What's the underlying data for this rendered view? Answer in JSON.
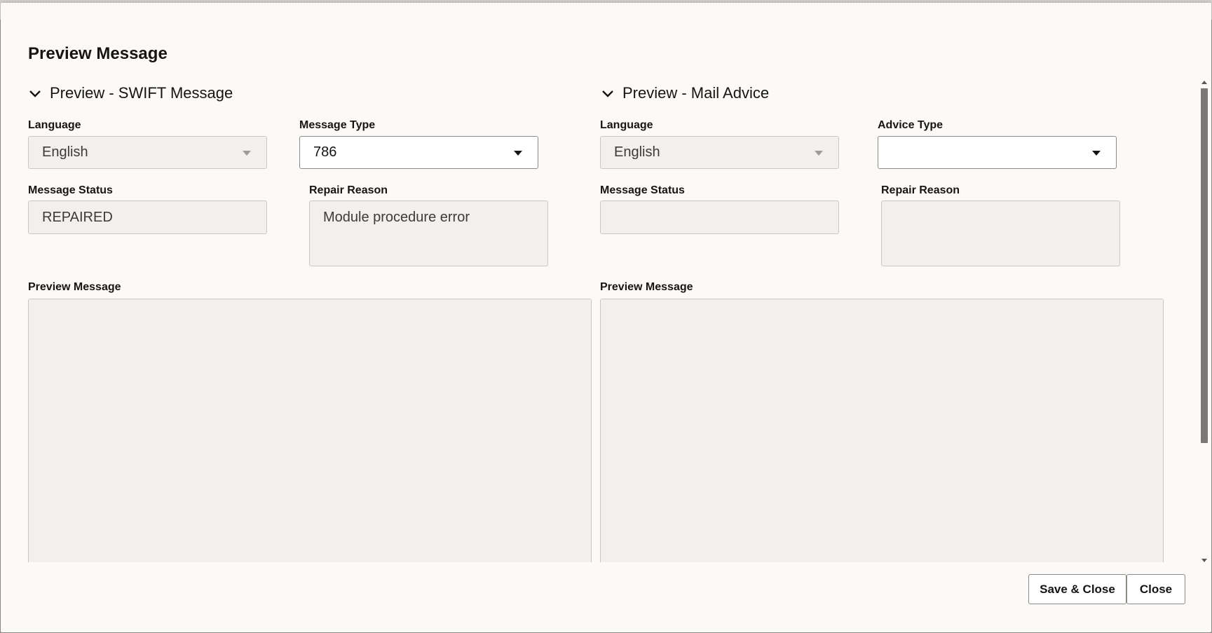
{
  "dialog": {
    "title": "Preview Message"
  },
  "swift": {
    "section_title": "Preview - SWIFT Message",
    "language": {
      "label": "Language",
      "value": "English"
    },
    "message_type": {
      "label": "Message Type",
      "value": "786"
    },
    "message_status": {
      "label": "Message Status",
      "value": "REPAIRED"
    },
    "repair_reason": {
      "label": "Repair Reason",
      "value": "Module procedure error"
    },
    "preview": {
      "label": "Preview Message",
      "value": ""
    }
  },
  "mail": {
    "section_title": "Preview - Mail Advice",
    "language": {
      "label": "Language",
      "value": "English"
    },
    "advice_type": {
      "label": "Advice Type",
      "value": ""
    },
    "message_status": {
      "label": "Message Status",
      "value": ""
    },
    "repair_reason": {
      "label": "Repair Reason",
      "value": ""
    },
    "preview": {
      "label": "Preview Message",
      "value": ""
    }
  },
  "footer": {
    "save_close_label": "Save & Close",
    "close_label": "Close"
  },
  "icons": {
    "section_toggle": "chevron-down-icon",
    "dropdown": "caret-down-icon"
  }
}
